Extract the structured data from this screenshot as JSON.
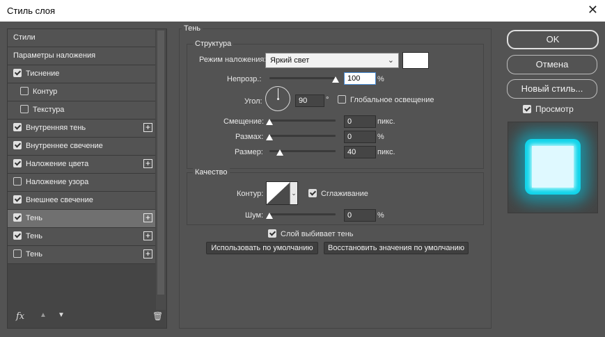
{
  "window": {
    "title": "Стиль слоя",
    "close_glyph": "✕"
  },
  "styles_list": [
    {
      "label": "Стили",
      "checkbox": false,
      "checked": false,
      "plus": false,
      "selected": false,
      "indent": false
    },
    {
      "label": "Параметры наложения",
      "checkbox": false,
      "checked": false,
      "plus": false,
      "selected": false,
      "indent": false
    },
    {
      "label": "Тиснение",
      "checkbox": true,
      "checked": true,
      "plus": false,
      "selected": false,
      "indent": false
    },
    {
      "label": "Контур",
      "checkbox": true,
      "checked": false,
      "plus": false,
      "selected": false,
      "indent": true
    },
    {
      "label": "Текстура",
      "checkbox": true,
      "checked": false,
      "plus": false,
      "selected": false,
      "indent": true
    },
    {
      "label": "Внутренняя тень",
      "checkbox": true,
      "checked": true,
      "plus": true,
      "selected": false,
      "indent": false
    },
    {
      "label": "Внутреннее свечение",
      "checkbox": true,
      "checked": true,
      "plus": false,
      "selected": false,
      "indent": false
    },
    {
      "label": "Наложение цвета",
      "checkbox": true,
      "checked": true,
      "plus": true,
      "selected": false,
      "indent": false
    },
    {
      "label": "Наложение узора",
      "checkbox": true,
      "checked": false,
      "plus": false,
      "selected": false,
      "indent": false
    },
    {
      "label": "Внешнее свечение",
      "checkbox": true,
      "checked": true,
      "plus": false,
      "selected": false,
      "indent": false
    },
    {
      "label": "Тень",
      "checkbox": true,
      "checked": true,
      "plus": true,
      "selected": true,
      "indent": false
    },
    {
      "label": "Тень",
      "checkbox": true,
      "checked": true,
      "plus": true,
      "selected": false,
      "indent": false
    },
    {
      "label": "Тень",
      "checkbox": true,
      "checked": false,
      "plus": true,
      "selected": false,
      "indent": false
    }
  ],
  "bottom_icons": {
    "fx": "fx",
    "up": "▲",
    "down": "▼",
    "trash": "🗑"
  },
  "shadow": {
    "group_title": "Тень",
    "structure_title": "Структура",
    "blend_label": "Режим наложения:",
    "blend_value": "Яркий свет",
    "blend_color": "#ffffff",
    "opacity_label": "Непрозр.:",
    "opacity_value": "100",
    "opacity_unit": "%",
    "opacity_level": 1.0,
    "angle_label": "Угол:",
    "angle_value": "90",
    "angle_unit": "°",
    "global_light_label": "Глобальное освещение",
    "global_light_checked": false,
    "offset_label": "Смещение:",
    "offset_value": "0",
    "offset_unit": "пикс.",
    "offset_level": 0.0,
    "spread_label": "Размах:",
    "spread_value": "0",
    "spread_unit": "%",
    "spread_level": 0.0,
    "size_label": "Размер:",
    "size_value": "40",
    "size_unit": "пикс.",
    "size_level": 0.16,
    "quality_title": "Качество",
    "contour_label": "Контур:",
    "antialias_label": "Сглаживание",
    "antialias_checked": true,
    "noise_label": "Шум:",
    "noise_value": "0",
    "noise_unit": "%",
    "noise_level": 0.0,
    "knockout_label": "Слой выбивает тень",
    "knockout_checked": true,
    "use_default_label": "Использовать по умолчанию",
    "restore_default_label": "Восстановить значения по умолчанию"
  },
  "right": {
    "ok_label": "OK",
    "cancel_label": "Отмена",
    "new_style_label": "Новый стиль...",
    "preview_label": "Просмотр",
    "preview_checked": true
  },
  "colors": {
    "panel": "#535353",
    "glow": "#11d4ea"
  }
}
